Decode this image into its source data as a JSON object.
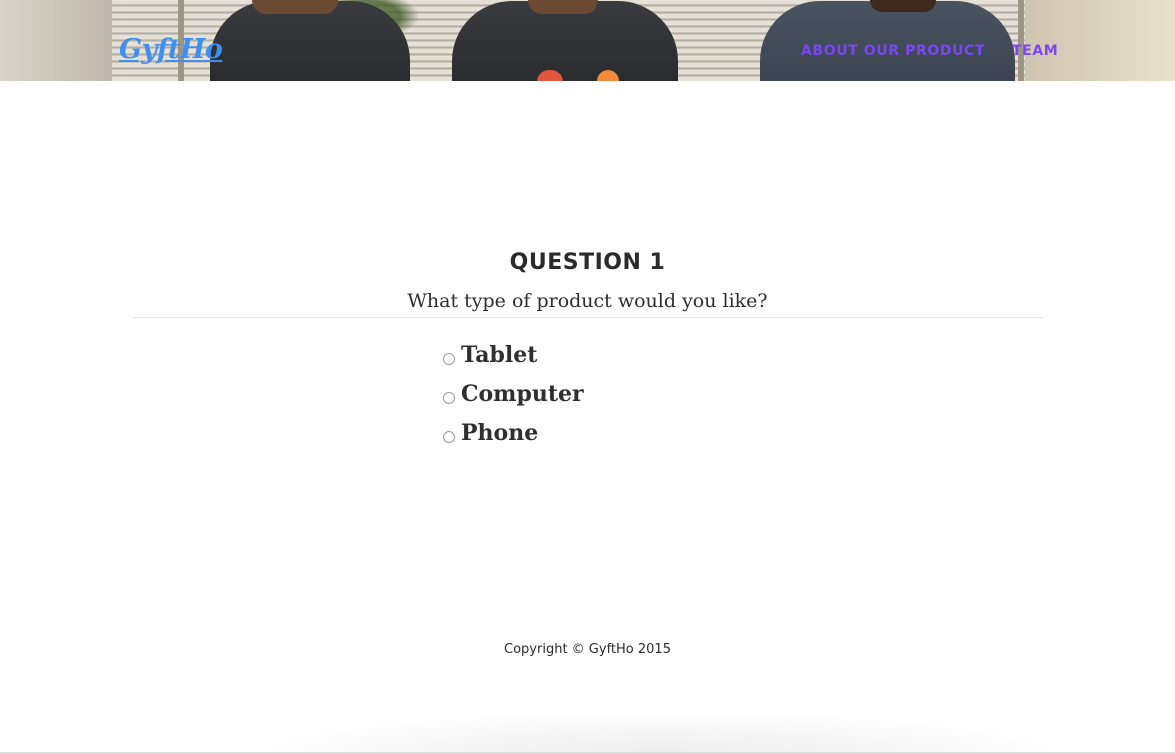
{
  "header": {
    "brand": "GyftHo",
    "nav": [
      {
        "label": "ABOUT OUR PRODUCT"
      },
      {
        "label": "TEAM"
      }
    ]
  },
  "question": {
    "title": "QUESTION 1",
    "text": "What type of product would you like?",
    "options": [
      {
        "label": "Tablet",
        "selected": false
      },
      {
        "label": "Computer",
        "selected": false
      },
      {
        "label": "Phone",
        "selected": false
      }
    ]
  },
  "footer": {
    "copyright": "Copyright © GyftHo 2015"
  },
  "colors": {
    "brand": "#3f8ff0",
    "nav_link": "#7b46f3",
    "text": "#2b2b2b"
  }
}
